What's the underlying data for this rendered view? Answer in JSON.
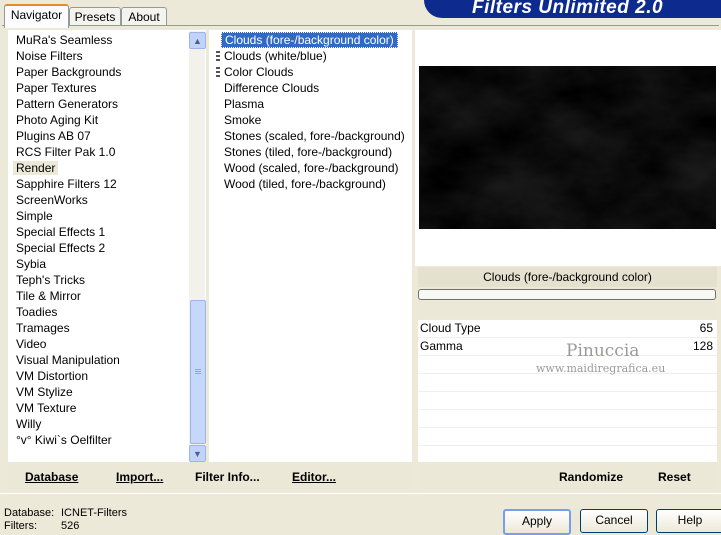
{
  "tabs": [
    {
      "label": "Navigator",
      "active": true
    },
    {
      "label": "Presets",
      "active": false
    },
    {
      "label": "About",
      "active": false
    }
  ],
  "banner": {
    "title": "Filters Unlimited 2.0"
  },
  "categories": {
    "items": [
      "MuRa's Seamless",
      "Noise Filters",
      "Paper Backgrounds",
      "Paper Textures",
      "Pattern Generators",
      "Photo Aging Kit",
      "Plugins AB 07",
      "RCS Filter Pak 1.0",
      "Render",
      "Sapphire Filters 12",
      "ScreenWorks",
      "Simple",
      "Special Effects 1",
      "Special Effects 2",
      "Sybia",
      "Teph's Tricks",
      "Tile & Mirror",
      "Toadies",
      "Tramages",
      "Video",
      "Visual Manipulation",
      "VM Distortion",
      "VM Stylize",
      "VM Texture",
      "Willy",
      "°v° Kiwi`s Oelfilter"
    ],
    "selected": "Render"
  },
  "filters": {
    "items": [
      "Clouds (fore-/background color)",
      "Clouds (white/blue)",
      "Color Clouds",
      "Difference Clouds",
      "Plasma",
      "Smoke",
      "Stones (scaled, fore-/background)",
      "Stones (tiled, fore-/background)",
      "Wood (scaled, fore-/background)",
      "Wood (tiled, fore-/background)"
    ],
    "selected": "Clouds (fore-/background color)"
  },
  "preview": {
    "caption": "Clouds (fore-/background color)"
  },
  "params": [
    {
      "label": "Cloud Type",
      "value": "65"
    },
    {
      "label": "Gamma",
      "value": "128"
    }
  ],
  "watermark": {
    "name": "Pinuccia",
    "site": "www.maidiregrafica.eu"
  },
  "buttons": {
    "database": "Database",
    "import": "Import...",
    "filter_info": "Filter Info...",
    "editor": "Editor...",
    "randomize": "Randomize",
    "reset": "Reset",
    "apply": "Apply",
    "cancel": "Cancel",
    "help": "Help"
  },
  "status": {
    "database_label": "Database:",
    "database_value": "ICNET-Filters",
    "filters_label": "Filters:",
    "filters_value": "526"
  },
  "colors": {
    "selection": "#316ac5",
    "banner": "#0d2a8f",
    "tab_accent": "#e68b2c"
  }
}
